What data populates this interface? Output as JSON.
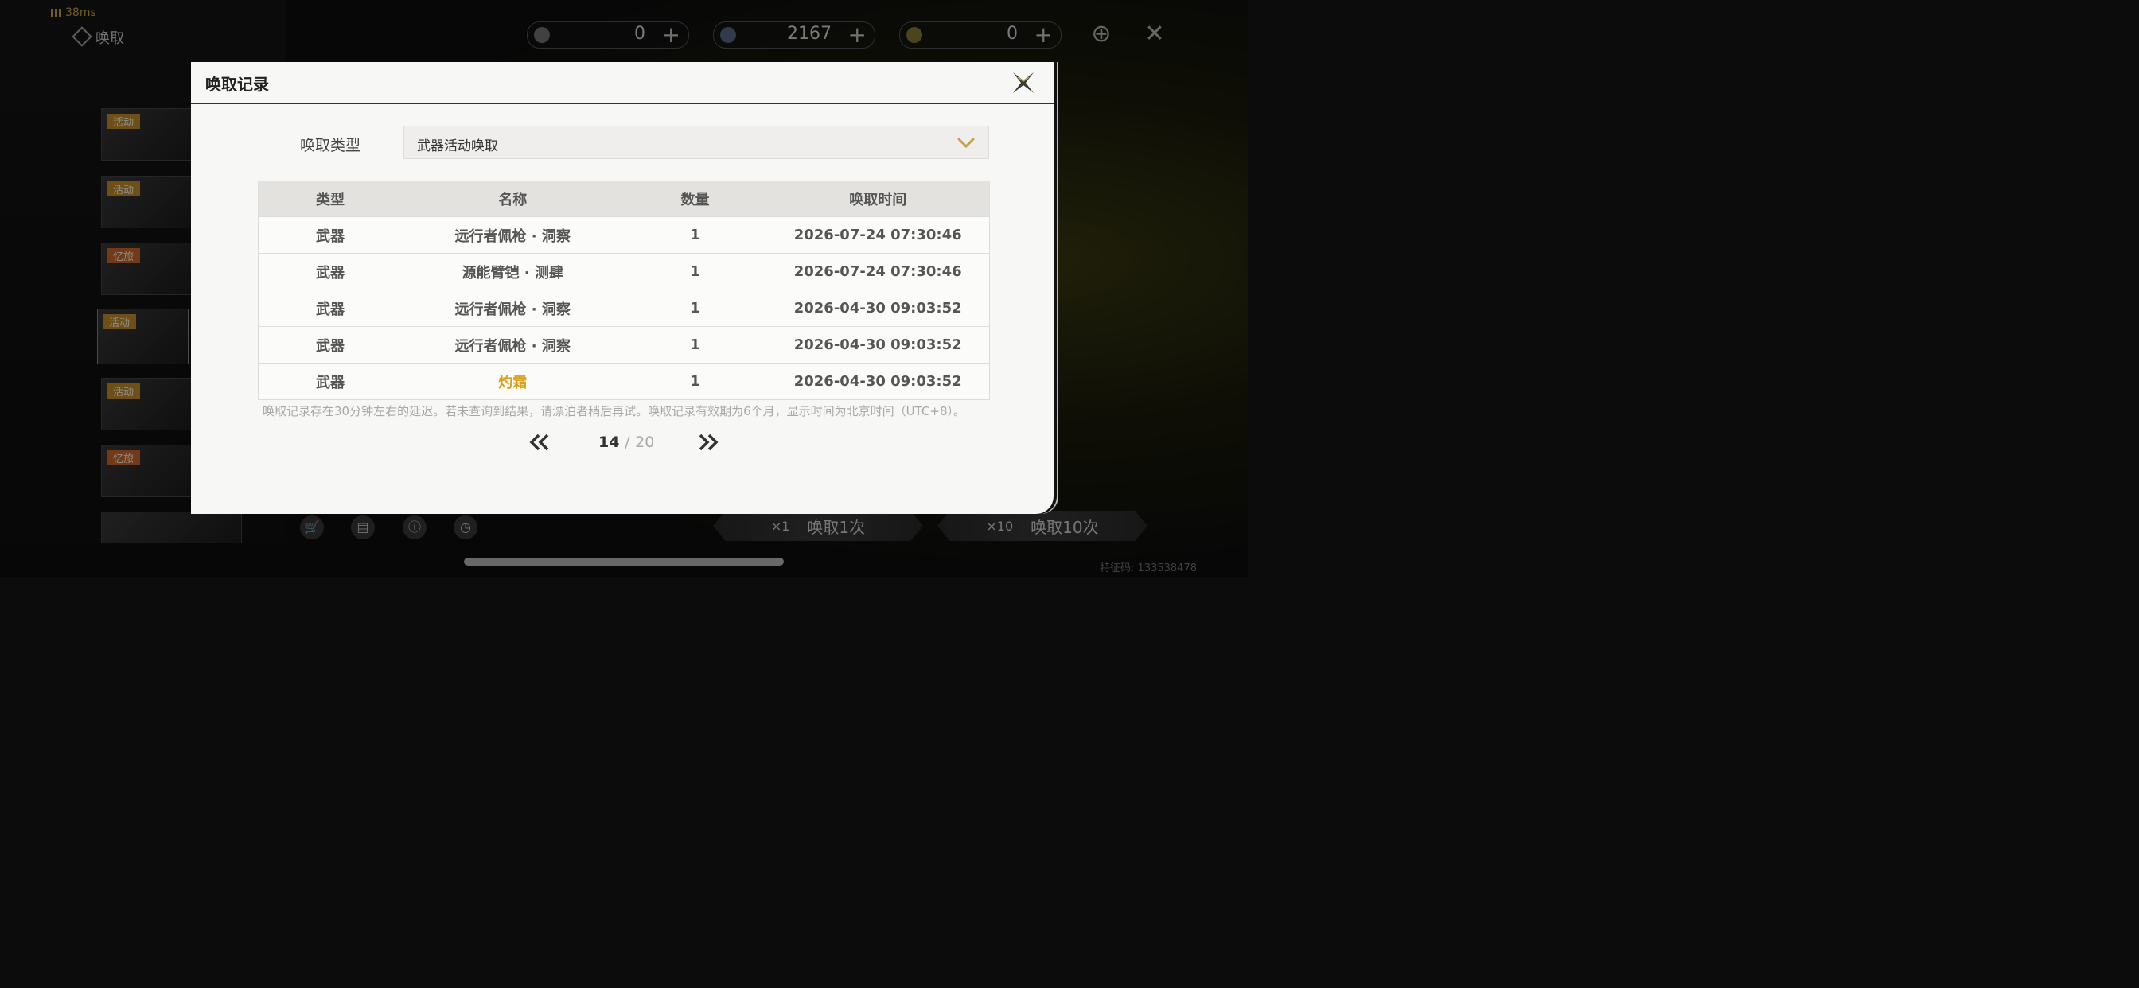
{
  "status": {
    "ping": "38ms"
  },
  "background": {
    "label": "唤取",
    "currencies": [
      {
        "icon": "lunite-orb-icon",
        "value": "0",
        "plus": "+"
      },
      {
        "icon": "astrite-icon",
        "value": "2167",
        "plus": "+"
      },
      {
        "icon": "tide-icon",
        "value": "0",
        "plus": "+"
      }
    ],
    "side_tags": [
      "活动",
      "活动",
      "忆旅",
      "活动",
      "活动",
      "忆旅"
    ],
    "buttons": {
      "single_mult": "×1",
      "single_label": "唤取1次",
      "ten_mult": "×10",
      "ten_label": "唤取10次"
    },
    "uid": "特征码: 133538478"
  },
  "modal": {
    "title": "唤取记录",
    "filter_label": "唤取类型",
    "filter_value": "武器活动唤取",
    "columns": [
      "类型",
      "名称",
      "数量",
      "唤取时间"
    ],
    "rows": [
      {
        "type": "武器",
        "name": "远行者佩枪 · 洞察",
        "qty": "1",
        "time": "2026-07-24 07:30:46"
      },
      {
        "type": "武器",
        "name": "源能臂铠 · 测肆",
        "qty": "1",
        "time": "2026-07-24 07:30:46"
      },
      {
        "type": "武器",
        "name": "远行者佩枪 · 洞察",
        "qty": "1",
        "time": "2026-04-30 09:03:52"
      },
      {
        "type": "武器",
        "name": "远行者佩枪 · 洞察",
        "qty": "1",
        "time": "2026-04-30 09:03:52"
      },
      {
        "type": "武器",
        "name": "灼霜",
        "qty": "1",
        "time": "2026-04-30 09:03:52"
      }
    ],
    "notice": "唤取记录存在30分钟左右的延迟。若未查询到结果，请漂泊者稍后再试。唤取记录有效期为6个月，显示时间为北京时间（UTC+8）。",
    "pager": {
      "current": "14",
      "sep": "/",
      "total": "20"
    }
  },
  "colors": {
    "accent_gold": "#d9a01b",
    "chevron": "#c9a04a"
  }
}
